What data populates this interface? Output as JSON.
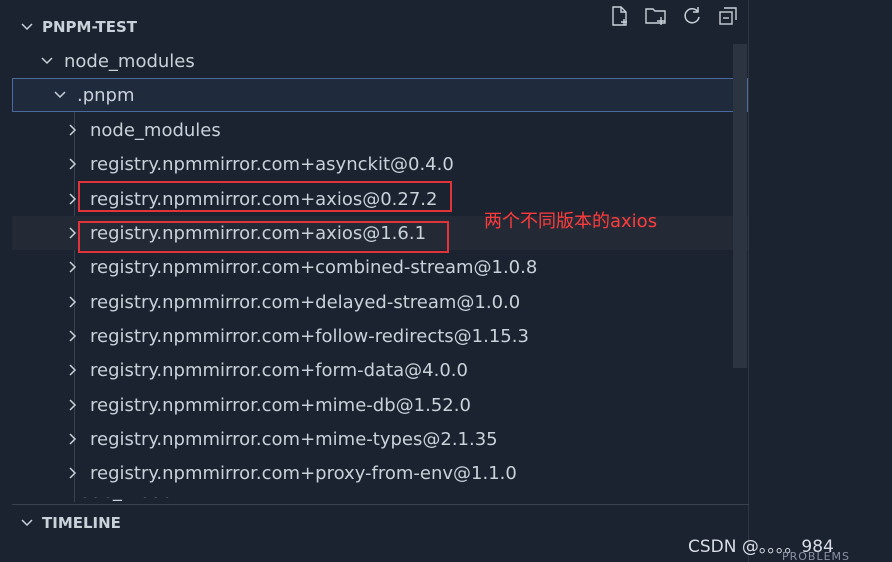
{
  "explorer": {
    "title": "PNPM-TEST",
    "actions": [
      {
        "name": "new-file-icon"
      },
      {
        "name": "new-folder-icon"
      },
      {
        "name": "refresh-icon"
      },
      {
        "name": "collapse-all-icon"
      }
    ]
  },
  "tree": {
    "root_folder": "node_modules",
    "pnpm_folder": ".pnpm",
    "items": [
      "node_modules",
      "registry.npmmirror.com+asynckit@0.4.0",
      "registry.npmmirror.com+axios@0.27.2",
      "registry.npmmirror.com+axios@1.6.1",
      "registry.npmmirror.com+combined-stream@1.0.8",
      "registry.npmmirror.com+delayed-stream@1.0.0",
      "registry.npmmirror.com+follow-redirects@1.15.3",
      "registry.npmmirror.com+form-data@4.0.0",
      "registry.npmmirror.com+mime-db@1.52.0",
      "registry.npmmirror.com+mime-types@2.1.35",
      "registry.npmmirror.com+proxy-from-env@1.1.0"
    ],
    "cut_item": "node_modules"
  },
  "annotation": "两个不同版本的axios",
  "timeline": {
    "title": "TIMELINE"
  },
  "watermark": "CSDN @。。。。984",
  "problems_tab": "PROBLEMS",
  "colors": {
    "annotation": "#ff3b3b",
    "selection_border": "#4c6aa0"
  }
}
